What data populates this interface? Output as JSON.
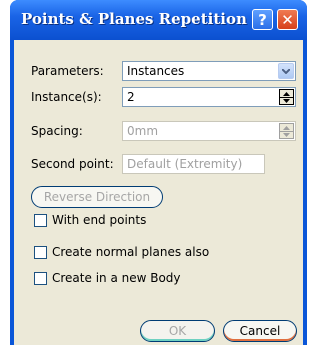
{
  "window": {
    "title": "Points & Planes Repetition"
  },
  "titlebar": {
    "help_glyph": "?",
    "close_glyph": "✕"
  },
  "form": {
    "parameters_label": "Parameters:",
    "parameters_value": "Instances",
    "instances_label": "Instance(s):",
    "instances_value": "2",
    "spacing_label": "Spacing:",
    "spacing_value": "0mm",
    "second_point_label": "Second point:",
    "second_point_value": "Default (Extremity)",
    "reverse_direction_label": "Reverse Direction"
  },
  "options": {
    "with_end_points": "With end points",
    "create_normal_planes": "Create normal planes also",
    "create_new_body": "Create in a new Body"
  },
  "footer": {
    "ok_label": "OK",
    "cancel_label": "Cancel"
  },
  "colors": {
    "titlebar": "#0b50d0",
    "client": "#ece9d8",
    "close": "#d6401c"
  }
}
